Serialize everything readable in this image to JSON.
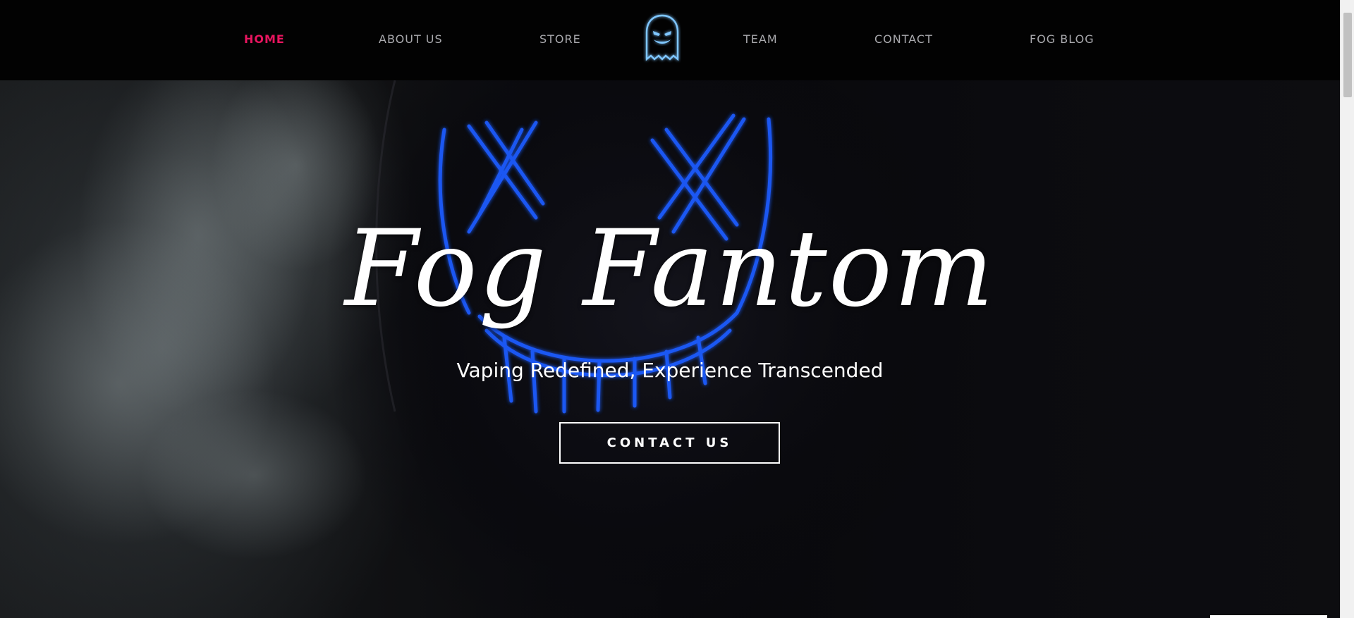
{
  "nav": {
    "items": [
      {
        "label": "HOME",
        "active": true
      },
      {
        "label": "ABOUT US",
        "active": false
      },
      {
        "label": "STORE",
        "active": false
      },
      {
        "label": "TEAM",
        "active": false
      },
      {
        "label": "CONTACT",
        "active": false
      },
      {
        "label": "FOG BLOG",
        "active": false
      }
    ],
    "logo_icon": "ghost-icon"
  },
  "hero": {
    "title": "Fog Fantom",
    "subtitle": "Vaping Redefined, Experience Transcended",
    "cta_label": "CONTACT US"
  },
  "colors": {
    "accent": "#e8155f",
    "nav_text": "#a9a9ad",
    "header_bg": "#020202",
    "neon_blue": "#1f5bff",
    "logo_glow": "#7fc6ff"
  }
}
